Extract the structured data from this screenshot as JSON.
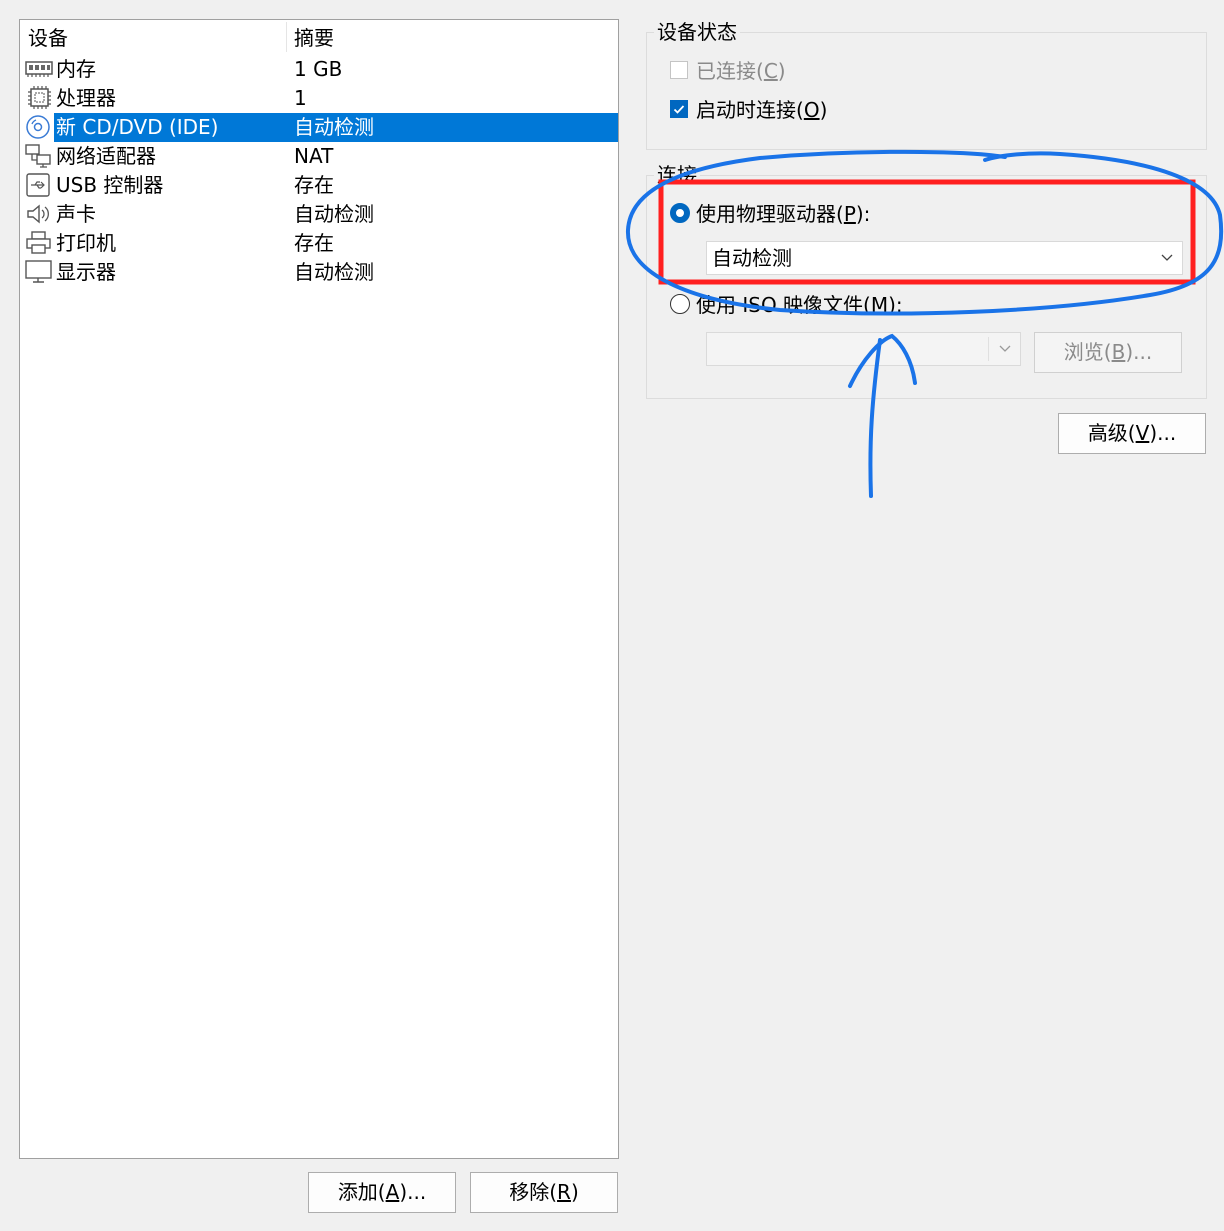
{
  "device_list": {
    "columns": {
      "device": "设备",
      "summary": "摘要"
    },
    "rows": [
      {
        "icon": "memory-icon",
        "name": "内存",
        "summary": "1 GB",
        "selected": false
      },
      {
        "icon": "processor-icon",
        "name": "处理器",
        "summary": "1",
        "selected": false
      },
      {
        "icon": "cd-dvd-icon",
        "name": "新 CD/DVD (IDE)",
        "summary": "自动检测",
        "selected": true
      },
      {
        "icon": "network-adapter-icon",
        "name": "网络适配器",
        "summary": "NAT",
        "selected": false
      },
      {
        "icon": "usb-controller-icon",
        "name": "USB 控制器",
        "summary": "存在",
        "selected": false
      },
      {
        "icon": "sound-card-icon",
        "name": "声卡",
        "summary": "自动检测",
        "selected": false
      },
      {
        "icon": "printer-icon",
        "name": "打印机",
        "summary": "存在",
        "selected": false
      },
      {
        "icon": "display-icon",
        "name": "显示器",
        "summary": "自动检测",
        "selected": false
      }
    ]
  },
  "buttons": {
    "add": {
      "text": "添加(",
      "mnemonic": "A",
      "suffix": ")..."
    },
    "remove": {
      "text": "移除(",
      "mnemonic": "R",
      "suffix": ")"
    },
    "browse": {
      "text": "浏览(",
      "mnemonic": "B",
      "suffix": ")..."
    },
    "advanced": {
      "text": "高级(",
      "mnemonic": "V",
      "suffix": ")..."
    }
  },
  "device_status": {
    "title": "设备状态",
    "connected": {
      "text": "已连接(",
      "mnemonic": "C",
      "suffix": ")",
      "checked": false,
      "enabled": false
    },
    "connect_at_power_on": {
      "text": "启动时连接(",
      "mnemonic": "O",
      "suffix": ")",
      "checked": true,
      "enabled": true
    }
  },
  "connection": {
    "title": "连接",
    "physical_drive": {
      "text": "使用物理驱动器(",
      "mnemonic": "P",
      "suffix": "):",
      "selected": true,
      "value": "自动检测"
    },
    "iso_image": {
      "text": "使用 ISO 映像文件(",
      "mnemonic": "M",
      "suffix": "):",
      "selected": false,
      "value": ""
    }
  },
  "colors": {
    "selection": "#0078d7",
    "checkbox_checked": "#0067c0",
    "annotation_red": "#ff0000",
    "annotation_blue": "#1a73e8"
  }
}
